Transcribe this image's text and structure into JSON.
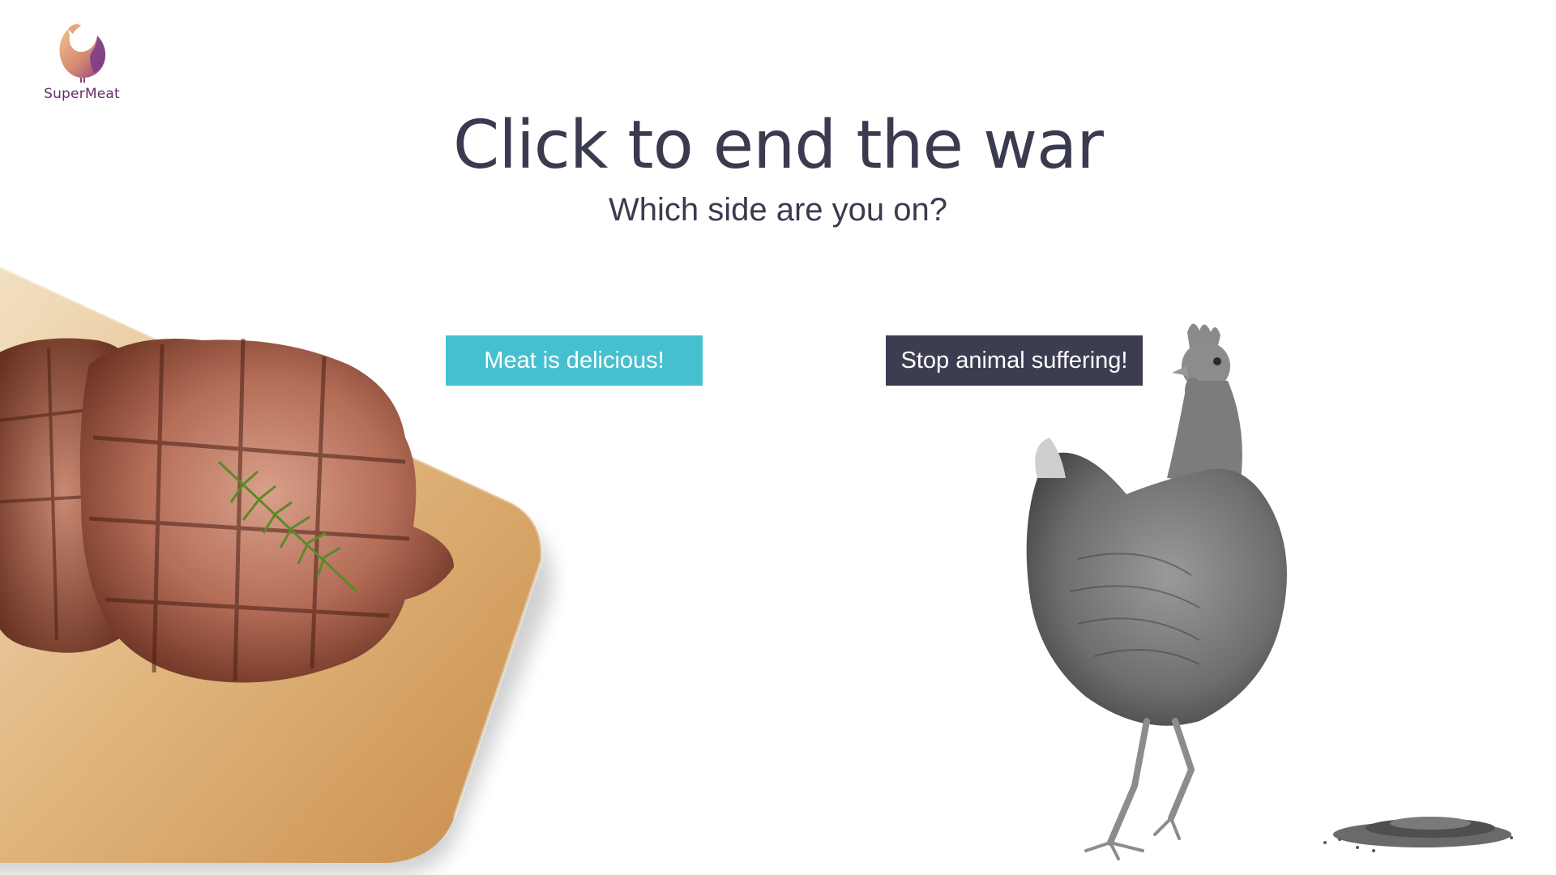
{
  "brand": {
    "name": "SuperMeat",
    "colors": {
      "purple": "#6a2a6e",
      "peach": "#e8a77a"
    }
  },
  "hero": {
    "title": "Click to end the war",
    "subtitle": "Which side are you on?"
  },
  "choices": {
    "meat_label": "Meat is delicious!",
    "animal_label": "Stop animal suffering!",
    "meat_color": "#46c0d0",
    "animal_color": "#3d3d52"
  },
  "images": {
    "left": "grilled-steaks-on-cutting-board",
    "right": "grayscale-hen",
    "seeds": "grain-pile"
  }
}
